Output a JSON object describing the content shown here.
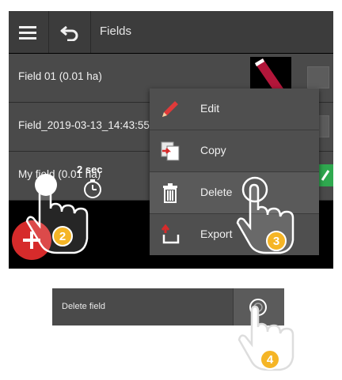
{
  "topbar": {
    "title": "Fields"
  },
  "fields": [
    {
      "label": "Field 01 (0.01 ha)"
    },
    {
      "label": "Field_2019-03-13_14:43:55"
    },
    {
      "label": "My field (0.01 ha)"
    }
  ],
  "context_menu": {
    "items": [
      {
        "label": "Edit",
        "icon": "pencil-icon"
      },
      {
        "label": "Copy",
        "icon": "copy-icon"
      },
      {
        "label": "Delete",
        "icon": "trash-icon",
        "selected": true
      },
      {
        "label": "Export",
        "icon": "export-icon"
      }
    ]
  },
  "hold": {
    "duration": "2 sec"
  },
  "steps": [
    "2",
    "3",
    "4"
  ],
  "delete_bar": {
    "label": "Delete field"
  },
  "colors": {
    "accent_red": "#d62b2b",
    "badge_yellow": "#f5b526",
    "confirm_green": "#2fa84f"
  }
}
